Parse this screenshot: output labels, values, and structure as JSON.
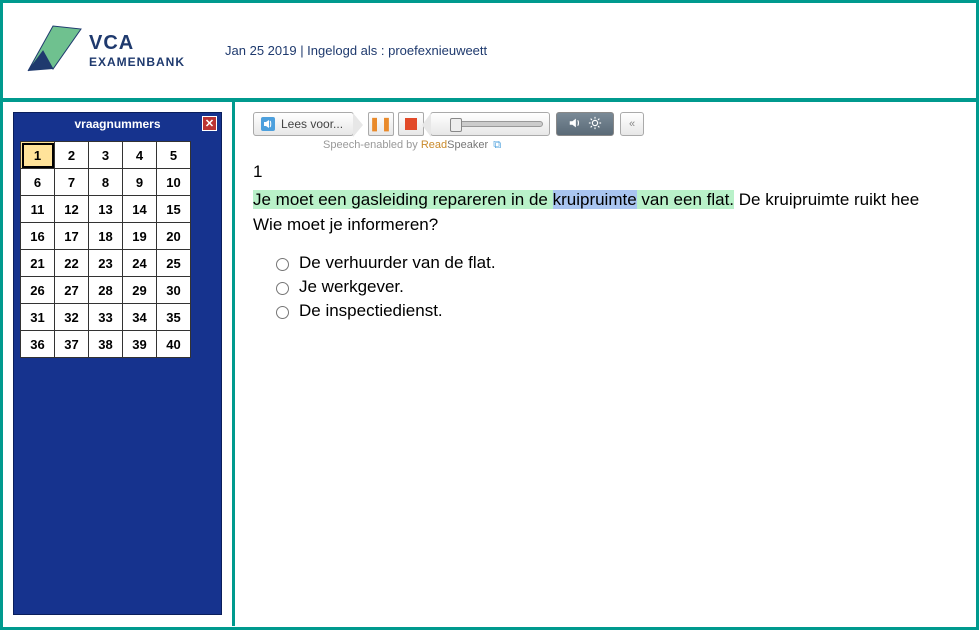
{
  "header": {
    "logo": {
      "line1": "VCA",
      "line2": "EXAMENBANK"
    },
    "status": "Jan 25 2019 | Ingelogd als : proefexnieuweett"
  },
  "sidebar": {
    "title": "vraagnummers",
    "count": 40,
    "current": 1
  },
  "readspeaker": {
    "label": "Lees voor...",
    "credit_prefix": "Speech-enabled by ",
    "credit_read": "Read",
    "credit_speaker": "Speaker"
  },
  "question": {
    "number": "1",
    "highlight_pre": "Je moet een gasleiding repareren in de ",
    "highlight_word": "kruipruimte",
    "highlight_post": " van een flat.",
    "rest": " De kruipruimte ruikt hee",
    "line2": "Wie moet je informeren?",
    "options": [
      "De verhuurder van de flat.",
      "Je werkgever.",
      "De inspectiedienst."
    ]
  }
}
